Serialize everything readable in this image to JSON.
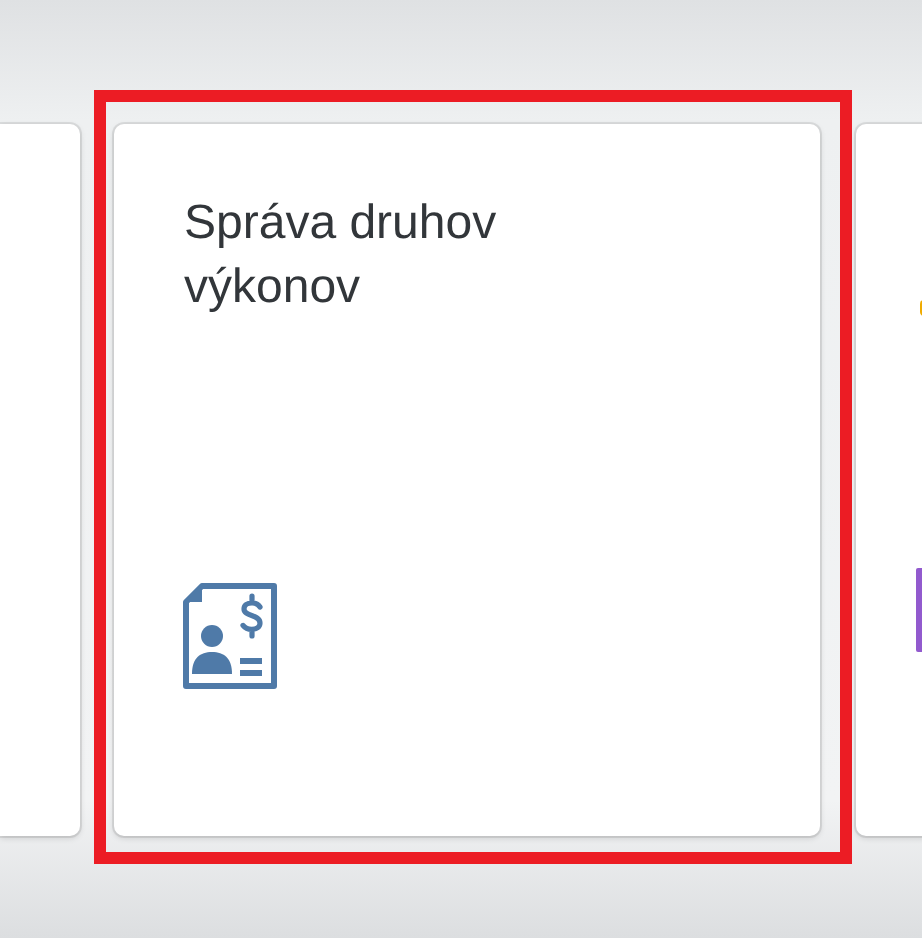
{
  "tiles": [
    {
      "kind": "partial"
    },
    {
      "kind": "app",
      "title": "Správa druhov výkonov",
      "highlighted": true
    },
    {
      "kind": "partial"
    }
  ]
}
